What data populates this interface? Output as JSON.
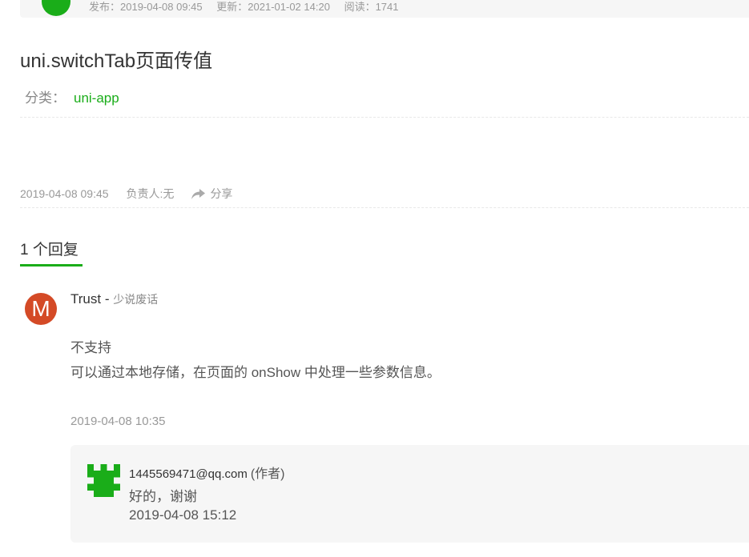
{
  "topbar": {
    "published": "发布：2019-04-08 09:45",
    "updated": "更新：2021-01-02 14:20",
    "views": "阅读：1741"
  },
  "question": {
    "title": "uni.switchTab页面传值",
    "category_label": "分类：",
    "category_value": "uni-app",
    "date": "2019-04-08 09:45",
    "owner": "负责人:无",
    "share_label": "分享"
  },
  "replies": {
    "header": "1 个回复",
    "items": [
      {
        "avatar_letter": "M",
        "author": "Trust",
        "separator": " - ",
        "motto": "少说废话",
        "line1": "不支持",
        "line2": "可以通过本地存储，在页面的 onShow 中处理一些参数信息。",
        "date": "2019-04-08 10:35",
        "sub": {
          "author": "1445569471@qq.com",
          "tag": "(作者)",
          "text": "好的，谢谢",
          "date": "2019-04-08 15:12"
        }
      }
    ]
  },
  "colors": {
    "accent": "#1aad19",
    "avatar_m": "#d44a26"
  },
  "icons": {
    "share": "share-arrow-icon"
  }
}
